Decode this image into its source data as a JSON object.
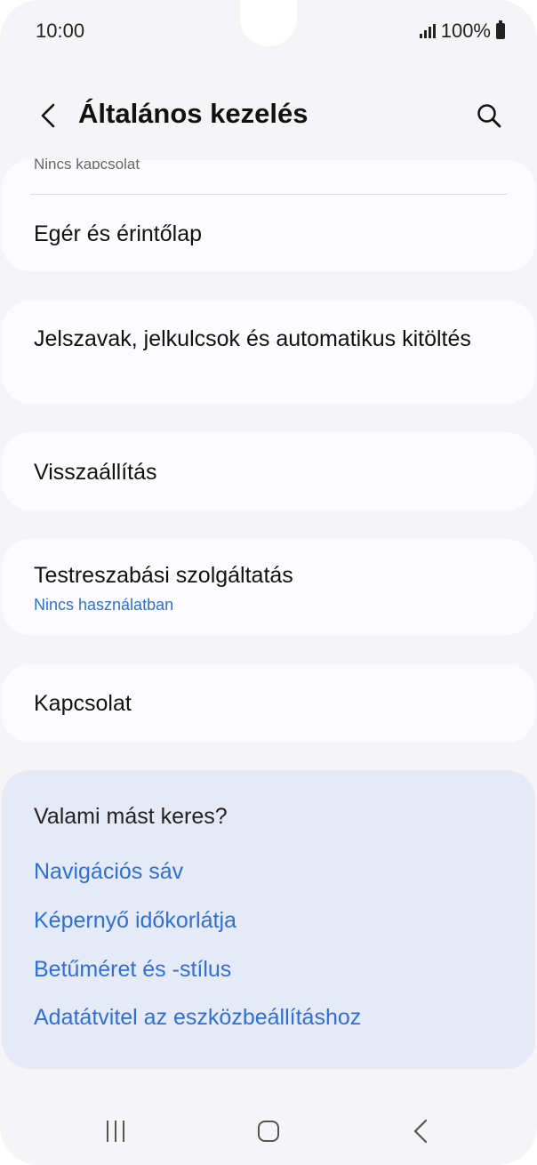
{
  "status_bar": {
    "time": "10:00",
    "battery": "100%"
  },
  "header": {
    "title": "Általános kezelés"
  },
  "partial_item_sub": "Nincs kapcsolat",
  "items": [
    {
      "label": "Egér és érintőlap"
    },
    {
      "label": "Jelszavak, jelkulcsok és automatikus kitöltés"
    },
    {
      "label": "Visszaállítás"
    },
    {
      "label": "Testreszabási szolgáltatás",
      "sub": "Nincs használatban"
    },
    {
      "label": "Kapcsolat"
    }
  ],
  "suggestions": {
    "title": "Valami mást keres?",
    "links": [
      "Navigációs sáv",
      "Képernyő időkorlátja",
      "Betűméret és -stílus",
      "Adatátvitel az eszközbeállításhoz"
    ]
  },
  "colors": {
    "link": "#2f6fd6",
    "background": "#f5f5f7",
    "card": "#fcfcfe",
    "suggest_bg": "#e6eaf6"
  }
}
